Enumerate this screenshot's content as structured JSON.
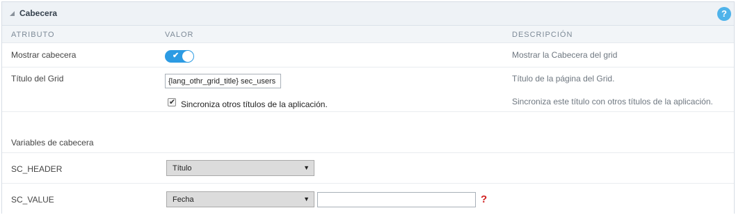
{
  "panel": {
    "title": "Cabecera",
    "help_label": "?"
  },
  "columns": {
    "attribute": "ATRIBUTO",
    "value": "VALOR",
    "description": "DESCRIPCIÓN"
  },
  "rows": {
    "show_header": {
      "label": "Mostrar cabecera",
      "toggle_on": true,
      "toggle_glyph": "✔",
      "description": "Mostrar la Cabecera del grid"
    },
    "grid_title": {
      "label": "Título del Grid",
      "value": "{lang_othr_grid_title} sec_users",
      "description": "Título de la página del Grid."
    },
    "sync_titles": {
      "checked": true,
      "check_glyph": "✔",
      "label": "Sincroniza otros títulos de la aplicación.",
      "description": "Sincroniza este título con otros títulos de la aplicación."
    },
    "header_variables": {
      "label": "Variables de cabecera"
    },
    "sc_header": {
      "label": "SC_HEADER",
      "selected": "Título",
      "arrow": "▼"
    },
    "sc_value": {
      "label": "SC_VALUE",
      "selected": "Fecha",
      "arrow": "▼",
      "input_value": "",
      "help_label": "?"
    }
  },
  "colors": {
    "accent": "#2c9be3",
    "help": "#4fb3ea",
    "error": "#d11f1f"
  }
}
